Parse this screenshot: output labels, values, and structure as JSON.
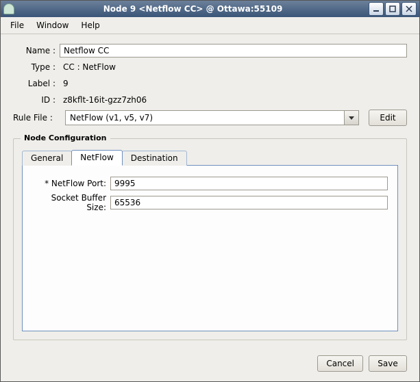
{
  "window": {
    "title": "Node 9 <Netflow CC> @ Ottawa:55109"
  },
  "menubar": {
    "file": "File",
    "window": "Window",
    "help": "Help"
  },
  "fields": {
    "name_label": "Name :",
    "name_value": "Netflow CC",
    "type_label": "Type :",
    "type_value": "CC : NetFlow",
    "label_label": "Label :",
    "label_value": "9",
    "id_label": "ID :",
    "id_value": "z8kflt-16it-gzz7zh06",
    "rulefile_label": "Rule File :",
    "rulefile_value": "NetFlow (v1, v5, v7)",
    "edit_button": "Edit"
  },
  "groupbox": {
    "title": "Node Configuration"
  },
  "tabs": {
    "general": "General",
    "netflow": "NetFlow",
    "destination": "Destination"
  },
  "netflow_tab": {
    "port_label": "* NetFlow Port:",
    "port_value": "9995",
    "buffer_label": "Socket Buffer Size:",
    "buffer_value": "65536"
  },
  "footer": {
    "cancel": "Cancel",
    "save": "Save"
  }
}
